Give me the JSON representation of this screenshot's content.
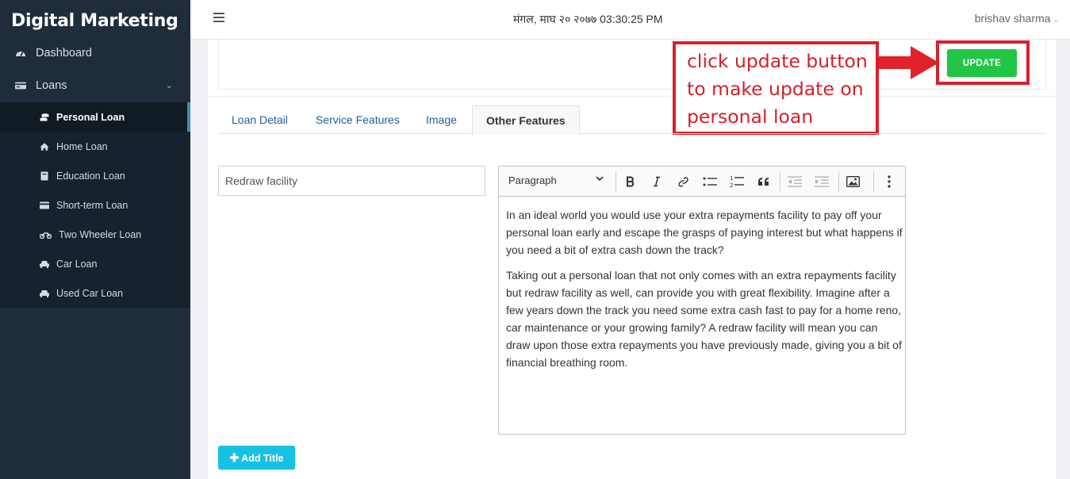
{
  "sidebar": {
    "brand": "Digital Marketing",
    "dashboard": "Dashboard",
    "loans": "Loans",
    "sub_items": [
      {
        "label": "Personal Loan",
        "icon": "coins-icon"
      },
      {
        "label": "Home Loan",
        "icon": "home-icon"
      },
      {
        "label": "Education Loan",
        "icon": "book-icon"
      },
      {
        "label": "Short-term Loan",
        "icon": "card-icon"
      },
      {
        "label": "Two Wheeler Loan",
        "icon": "motorcycle-icon"
      },
      {
        "label": "Car Loan",
        "icon": "car-icon"
      },
      {
        "label": "Used Car Loan",
        "icon": "car-icon"
      }
    ]
  },
  "header": {
    "datetime": "मंगल, माघ २० २०७७ 03:30:25 PM",
    "user": "brishav sharma"
  },
  "actions": {
    "update_label": "UPDATE",
    "add_title_label": "Add Title"
  },
  "annotation": {
    "lines": [
      "click update button",
      "to make update on",
      "personal loan"
    ]
  },
  "tabs": [
    "Loan Detail",
    "Service Features",
    "Image",
    "Other Features"
  ],
  "active_tab": "Other Features",
  "feature": {
    "title_value": "Redraw facility"
  },
  "editor": {
    "block_style": "Paragraph",
    "paragraphs": [
      "In an ideal world you would use your extra repayments facility to pay off your personal loan early and escape the grasps of paying interest but what happens if you need a bit of extra cash down the track?",
      "Taking out a personal loan that not only comes with an extra repayments facility but redraw facility as well, can provide you with great flexibility. Imagine after a few years down the track you need some extra cash fast to pay for a home reno, car maintenance or your growing family? A redraw facility will mean you can draw upon those extra repayments you have previously made, giving you a bit of financial breathing room."
    ]
  },
  "colors": {
    "sidebar_bg": "#1f2d3a",
    "submenu_bg": "#16222d",
    "update_green": "#22c545",
    "add_cyan": "#17c1e3",
    "annotation_red": "#d8202a",
    "link_blue": "#1f5f97"
  }
}
